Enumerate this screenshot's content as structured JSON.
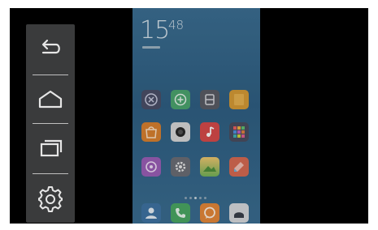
{
  "phone": {
    "clock_hour": "15",
    "clock_minute": "48"
  },
  "nav": {
    "back_icon": "back-arrow-icon",
    "home_icon": "home-icon",
    "recents_icon": "recent-apps-icon",
    "settings_icon": "gear-icon"
  },
  "colors": {
    "navbar_bg": "#3a3b3c",
    "icon_stroke": "#e6e6e6"
  }
}
